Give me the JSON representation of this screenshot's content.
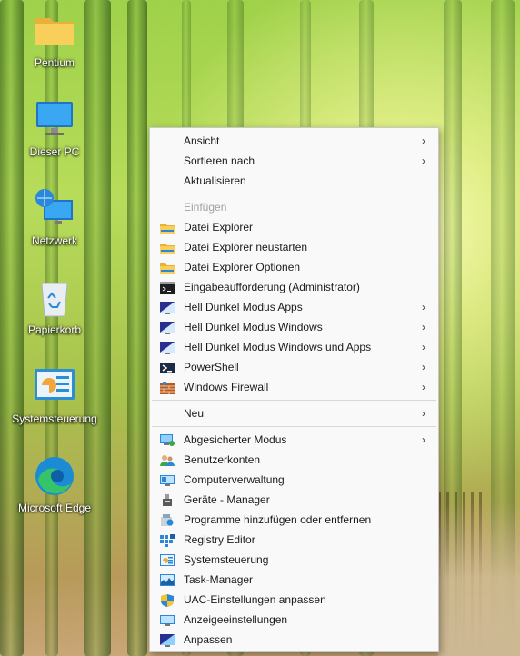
{
  "desktop": {
    "icons": [
      {
        "label": "Pentium",
        "icon": "folder-icon"
      },
      {
        "label": "Dieser PC",
        "icon": "monitor-icon"
      },
      {
        "label": "Netzwerk",
        "icon": "network-icon"
      },
      {
        "label": "Papierkorb",
        "icon": "recycle-bin-icon"
      },
      {
        "label": "Systemsteuerung",
        "icon": "control-panel-icon"
      },
      {
        "label": "Microsoft Edge",
        "icon": "edge-icon"
      }
    ]
  },
  "context_menu": {
    "items": [
      {
        "label": "Ansicht",
        "submenu": true
      },
      {
        "label": "Sortieren nach",
        "submenu": true
      },
      {
        "label": "Aktualisieren",
        "submenu": false
      },
      {
        "label": "Einfügen",
        "disabled": true
      },
      {
        "label": "Datei Explorer",
        "icon": "folder-icon"
      },
      {
        "label": "Datei Explorer neustarten",
        "icon": "folder-icon"
      },
      {
        "label": "Datei Explorer Optionen",
        "icon": "folder-icon"
      },
      {
        "label": "Eingabeaufforderung (Administrator)",
        "icon": "cmd-icon"
      },
      {
        "label": "Hell Dunkel Modus Apps",
        "icon": "display-mode-icon",
        "submenu": true
      },
      {
        "label": "Hell Dunkel Modus Windows",
        "icon": "display-mode-icon",
        "submenu": true
      },
      {
        "label": "Hell Dunkel Modus Windows und Apps",
        "icon": "display-mode-icon",
        "submenu": true
      },
      {
        "label": "PowerShell",
        "icon": "powershell-icon",
        "submenu": true
      },
      {
        "label": "Windows Firewall",
        "icon": "firewall-icon",
        "submenu": true
      },
      {
        "label": "Neu",
        "submenu": true
      },
      {
        "label": "Abgesicherter Modus",
        "icon": "safe-mode-icon",
        "submenu": true
      },
      {
        "label": "Benutzerkonten",
        "icon": "user-accounts-icon"
      },
      {
        "label": "Computerverwaltung",
        "icon": "computer-management-icon"
      },
      {
        "label": "Geräte - Manager",
        "icon": "device-manager-icon"
      },
      {
        "label": "Programme hinzufügen oder entfernen",
        "icon": "programs-icon"
      },
      {
        "label": "Registry Editor",
        "icon": "registry-icon"
      },
      {
        "label": "Systemsteuerung",
        "icon": "control-panel-icon"
      },
      {
        "label": "Task-Manager",
        "icon": "task-manager-icon"
      },
      {
        "label": "UAC-Einstellungen anpassen",
        "icon": "uac-shield-icon"
      },
      {
        "label": "Anzeigeeinstellungen",
        "icon": "display-settings-icon"
      },
      {
        "label": "Anpassen",
        "icon": "personalize-icon"
      }
    ],
    "submenu_arrow": "›"
  }
}
